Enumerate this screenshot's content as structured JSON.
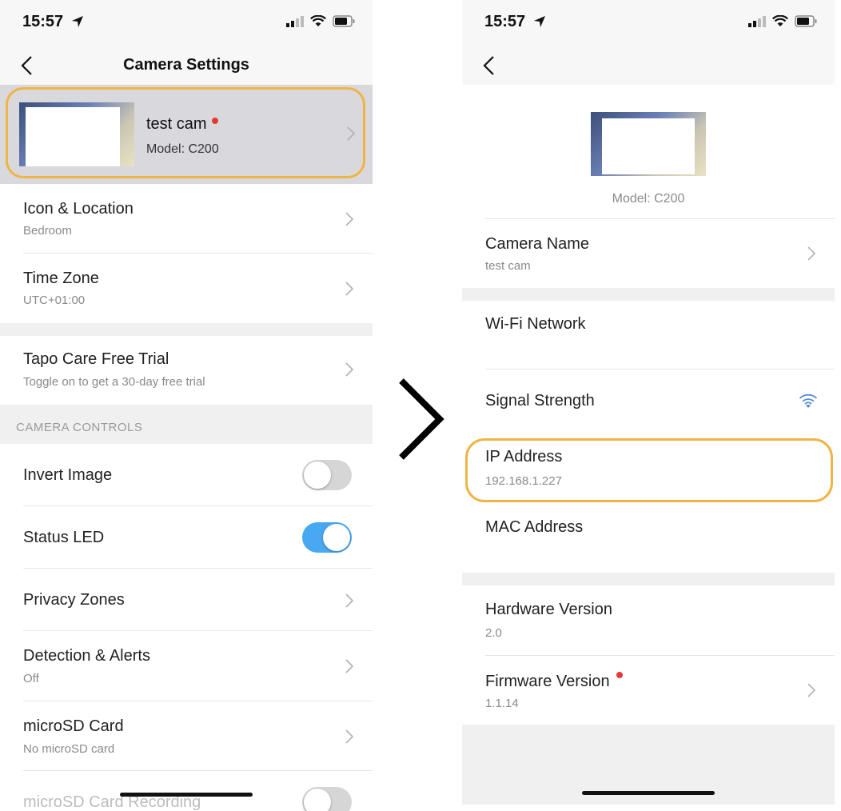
{
  "left": {
    "status": {
      "time": "15:57"
    },
    "nav": {
      "title": "Camera Settings"
    },
    "camera": {
      "name": "test cam",
      "model": "Model: C200"
    },
    "rows": {
      "icon_location": {
        "title": "Icon & Location",
        "sub": "Bedroom"
      },
      "time_zone": {
        "title": "Time Zone",
        "sub": "UTC+01:00"
      },
      "care_trial": {
        "title": "Tapo Care Free Trial",
        "sub": "Toggle on to get a 30-day free trial"
      },
      "section_controls": "CAMERA CONTROLS",
      "invert_image": {
        "title": "Invert Image",
        "state": "off"
      },
      "status_led": {
        "title": "Status LED",
        "state": "on"
      },
      "privacy_zones": {
        "title": "Privacy Zones"
      },
      "detection_alerts": {
        "title": "Detection & Alerts",
        "sub": "Off"
      },
      "microsd_card": {
        "title": "microSD Card",
        "sub": "No microSD card"
      },
      "microsd_recording": {
        "title": "microSD Card Recording"
      }
    }
  },
  "right": {
    "status": {
      "time": "15:57"
    },
    "model": "Model: C200",
    "rows": {
      "camera_name": {
        "title": "Camera Name",
        "sub": "test cam"
      },
      "wifi_network": {
        "title": "Wi-Fi Network"
      },
      "signal_strength": {
        "title": "Signal Strength"
      },
      "ip_address": {
        "title": "IP Address",
        "sub": "192.168.1.227"
      },
      "mac_address": {
        "title": "MAC Address"
      },
      "hardware_version": {
        "title": "Hardware Version",
        "sub": "2.0"
      },
      "firmware_version": {
        "title": "Firmware Version",
        "sub": "1.1.14"
      }
    }
  },
  "colors": {
    "highlight": "#f0b444",
    "toggle_on": "#49a8f2",
    "badge_red": "#e53935"
  },
  "icons": [
    "location-arrow-icon",
    "signal-bars-icon",
    "wifi-icon",
    "battery-icon",
    "back-chevron-icon",
    "chevron-right-icon",
    "wifi-signal-icon",
    "transition-chevron-icon"
  ]
}
